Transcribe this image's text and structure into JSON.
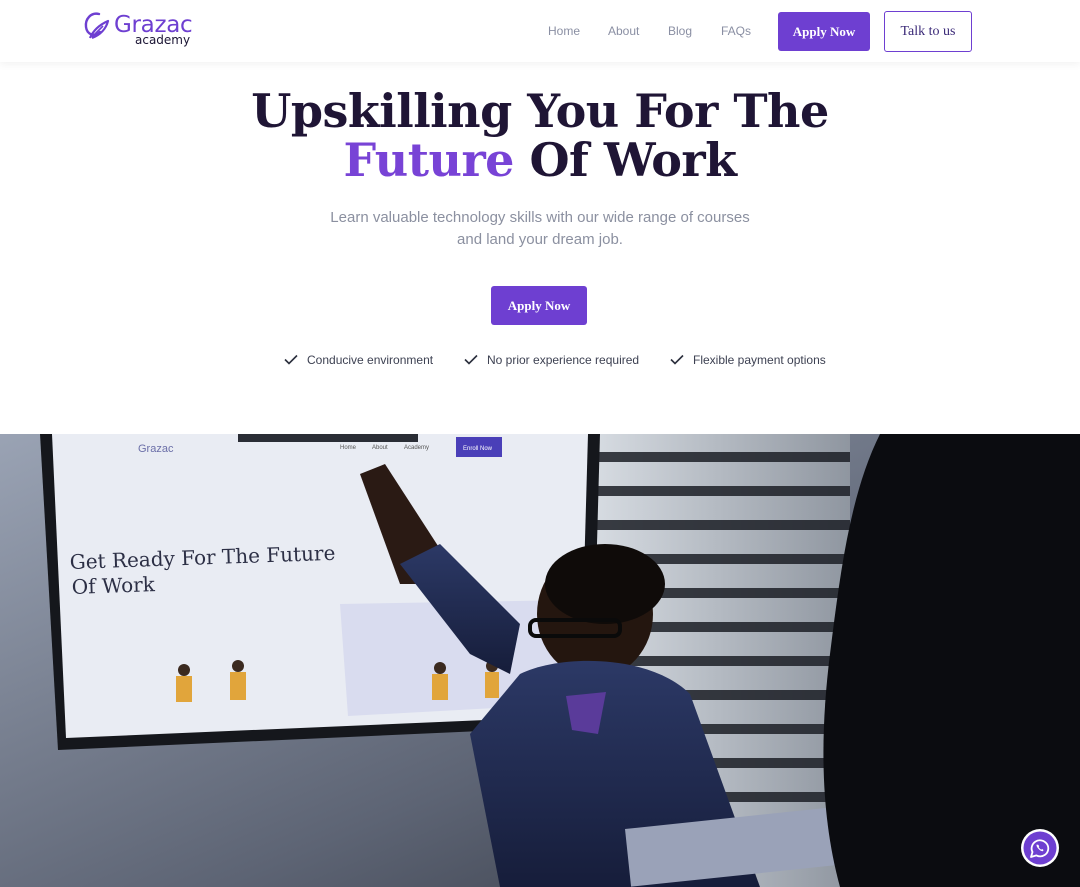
{
  "nav": {
    "logo": {
      "brand": "Grazac",
      "sub": "academy"
    },
    "links": [
      "Home",
      "About",
      "Blog",
      "FAQs"
    ],
    "apply_label": "Apply Now",
    "talk_label": "Talk to us"
  },
  "hero": {
    "title_line1": "Upskilling You For The",
    "title_accent": "Future",
    "title_rest": "Of Work",
    "subtitle_line1": "Learn valuable technology skills with our wide range of courses",
    "subtitle_line2": "and land your dream job.",
    "cta_label": "Apply Now",
    "features": [
      "Conducive environment",
      "No prior experience required",
      "Flexible payment options"
    ]
  },
  "video": {
    "screen_brand": "Grazac",
    "screen_nav": [
      "Home",
      "About",
      "Academy"
    ],
    "screen_button": "Enroll Now",
    "screen_title_line1": "Get Ready For The Future",
    "screen_title_line2": "Of Work"
  },
  "colors": {
    "accent": "#6e3fd1",
    "heading": "#1f1535",
    "muted": "#8b90a0",
    "whatsapp": "#6e3fd1"
  },
  "icons": {
    "feature": "check-icon",
    "floating": "whatsapp-icon"
  }
}
